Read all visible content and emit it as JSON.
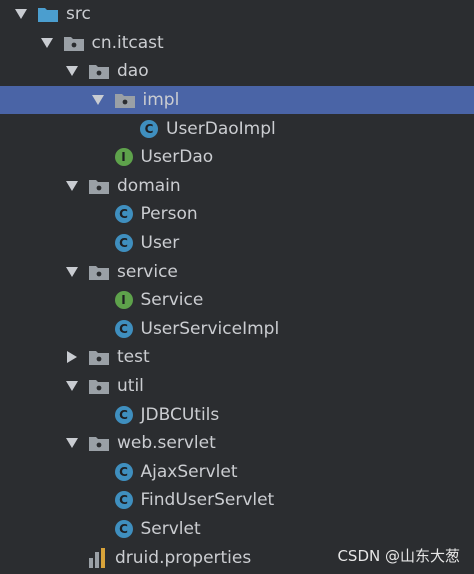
{
  "tree": [
    {
      "label": "src",
      "type": "source-folder",
      "depth": 0,
      "arrow": "down",
      "selected": false
    },
    {
      "label": "cn.itcast",
      "type": "package",
      "depth": 1,
      "arrow": "down",
      "selected": false
    },
    {
      "label": "dao",
      "type": "package",
      "depth": 2,
      "arrow": "down",
      "selected": false
    },
    {
      "label": "impl",
      "type": "package",
      "depth": 3,
      "arrow": "down",
      "selected": true
    },
    {
      "label": "UserDaoImpl",
      "type": "class",
      "depth": 4,
      "arrow": "none",
      "selected": false
    },
    {
      "label": "UserDao",
      "type": "interface",
      "depth": 3,
      "arrow": "none",
      "selected": false
    },
    {
      "label": "domain",
      "type": "package",
      "depth": 2,
      "arrow": "down",
      "selected": false
    },
    {
      "label": "Person",
      "type": "class",
      "depth": 3,
      "arrow": "none",
      "selected": false
    },
    {
      "label": "User",
      "type": "class",
      "depth": 3,
      "arrow": "none",
      "selected": false
    },
    {
      "label": "service",
      "type": "package",
      "depth": 2,
      "arrow": "down",
      "selected": false
    },
    {
      "label": "Service",
      "type": "interface",
      "depth": 3,
      "arrow": "none",
      "selected": false
    },
    {
      "label": "UserServiceImpl",
      "type": "class",
      "depth": 3,
      "arrow": "none",
      "selected": false
    },
    {
      "label": "test",
      "type": "package",
      "depth": 2,
      "arrow": "right",
      "selected": false
    },
    {
      "label": "util",
      "type": "package",
      "depth": 2,
      "arrow": "down",
      "selected": false
    },
    {
      "label": "JDBCUtils",
      "type": "class",
      "depth": 3,
      "arrow": "none",
      "selected": false
    },
    {
      "label": "web.servlet",
      "type": "package",
      "depth": 2,
      "arrow": "down",
      "selected": false
    },
    {
      "label": "AjaxServlet",
      "type": "class",
      "depth": 3,
      "arrow": "none",
      "selected": false
    },
    {
      "label": "FindUserServlet",
      "type": "class",
      "depth": 3,
      "arrow": "none",
      "selected": false
    },
    {
      "label": "Servlet",
      "type": "class",
      "depth": 3,
      "arrow": "none",
      "selected": false
    },
    {
      "label": "druid.properties",
      "type": "properties",
      "depth": 2,
      "arrow": "none",
      "selected": false
    }
  ],
  "icons": {
    "class": {
      "glyph": "C",
      "name": "class-icon"
    },
    "interface": {
      "glyph": "I",
      "name": "interface-icon"
    }
  },
  "colors": {
    "background": "#2b2d30",
    "selection": "#4a64a6",
    "text": "#cbcdd1",
    "class_badge": "#3f8fbf",
    "interface_badge": "#5ea24b",
    "source_folder": "#4b9ecf",
    "package_folder": "#9aa0a6"
  },
  "watermark": "CSDN @山东大葱"
}
